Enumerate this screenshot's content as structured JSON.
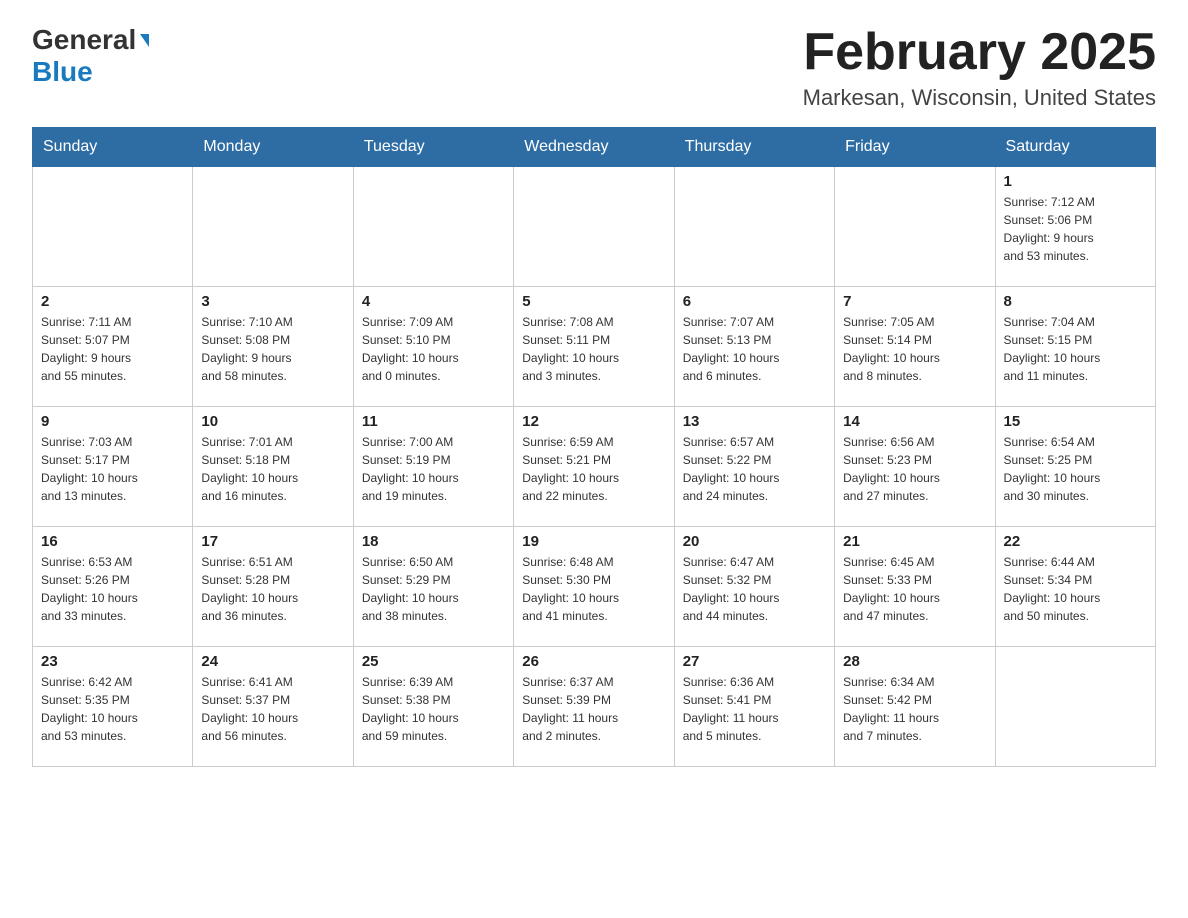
{
  "header": {
    "logo_line1": "General",
    "logo_line2": "Blue",
    "title": "February 2025",
    "subtitle": "Markesan, Wisconsin, United States"
  },
  "weekdays": [
    "Sunday",
    "Monday",
    "Tuesday",
    "Wednesday",
    "Thursday",
    "Friday",
    "Saturday"
  ],
  "weeks": [
    [
      {
        "day": "",
        "info": ""
      },
      {
        "day": "",
        "info": ""
      },
      {
        "day": "",
        "info": ""
      },
      {
        "day": "",
        "info": ""
      },
      {
        "day": "",
        "info": ""
      },
      {
        "day": "",
        "info": ""
      },
      {
        "day": "1",
        "info": "Sunrise: 7:12 AM\nSunset: 5:06 PM\nDaylight: 9 hours\nand 53 minutes."
      }
    ],
    [
      {
        "day": "2",
        "info": "Sunrise: 7:11 AM\nSunset: 5:07 PM\nDaylight: 9 hours\nand 55 minutes."
      },
      {
        "day": "3",
        "info": "Sunrise: 7:10 AM\nSunset: 5:08 PM\nDaylight: 9 hours\nand 58 minutes."
      },
      {
        "day": "4",
        "info": "Sunrise: 7:09 AM\nSunset: 5:10 PM\nDaylight: 10 hours\nand 0 minutes."
      },
      {
        "day": "5",
        "info": "Sunrise: 7:08 AM\nSunset: 5:11 PM\nDaylight: 10 hours\nand 3 minutes."
      },
      {
        "day": "6",
        "info": "Sunrise: 7:07 AM\nSunset: 5:13 PM\nDaylight: 10 hours\nand 6 minutes."
      },
      {
        "day": "7",
        "info": "Sunrise: 7:05 AM\nSunset: 5:14 PM\nDaylight: 10 hours\nand 8 minutes."
      },
      {
        "day": "8",
        "info": "Sunrise: 7:04 AM\nSunset: 5:15 PM\nDaylight: 10 hours\nand 11 minutes."
      }
    ],
    [
      {
        "day": "9",
        "info": "Sunrise: 7:03 AM\nSunset: 5:17 PM\nDaylight: 10 hours\nand 13 minutes."
      },
      {
        "day": "10",
        "info": "Sunrise: 7:01 AM\nSunset: 5:18 PM\nDaylight: 10 hours\nand 16 minutes."
      },
      {
        "day": "11",
        "info": "Sunrise: 7:00 AM\nSunset: 5:19 PM\nDaylight: 10 hours\nand 19 minutes."
      },
      {
        "day": "12",
        "info": "Sunrise: 6:59 AM\nSunset: 5:21 PM\nDaylight: 10 hours\nand 22 minutes."
      },
      {
        "day": "13",
        "info": "Sunrise: 6:57 AM\nSunset: 5:22 PM\nDaylight: 10 hours\nand 24 minutes."
      },
      {
        "day": "14",
        "info": "Sunrise: 6:56 AM\nSunset: 5:23 PM\nDaylight: 10 hours\nand 27 minutes."
      },
      {
        "day": "15",
        "info": "Sunrise: 6:54 AM\nSunset: 5:25 PM\nDaylight: 10 hours\nand 30 minutes."
      }
    ],
    [
      {
        "day": "16",
        "info": "Sunrise: 6:53 AM\nSunset: 5:26 PM\nDaylight: 10 hours\nand 33 minutes."
      },
      {
        "day": "17",
        "info": "Sunrise: 6:51 AM\nSunset: 5:28 PM\nDaylight: 10 hours\nand 36 minutes."
      },
      {
        "day": "18",
        "info": "Sunrise: 6:50 AM\nSunset: 5:29 PM\nDaylight: 10 hours\nand 38 minutes."
      },
      {
        "day": "19",
        "info": "Sunrise: 6:48 AM\nSunset: 5:30 PM\nDaylight: 10 hours\nand 41 minutes."
      },
      {
        "day": "20",
        "info": "Sunrise: 6:47 AM\nSunset: 5:32 PM\nDaylight: 10 hours\nand 44 minutes."
      },
      {
        "day": "21",
        "info": "Sunrise: 6:45 AM\nSunset: 5:33 PM\nDaylight: 10 hours\nand 47 minutes."
      },
      {
        "day": "22",
        "info": "Sunrise: 6:44 AM\nSunset: 5:34 PM\nDaylight: 10 hours\nand 50 minutes."
      }
    ],
    [
      {
        "day": "23",
        "info": "Sunrise: 6:42 AM\nSunset: 5:35 PM\nDaylight: 10 hours\nand 53 minutes."
      },
      {
        "day": "24",
        "info": "Sunrise: 6:41 AM\nSunset: 5:37 PM\nDaylight: 10 hours\nand 56 minutes."
      },
      {
        "day": "25",
        "info": "Sunrise: 6:39 AM\nSunset: 5:38 PM\nDaylight: 10 hours\nand 59 minutes."
      },
      {
        "day": "26",
        "info": "Sunrise: 6:37 AM\nSunset: 5:39 PM\nDaylight: 11 hours\nand 2 minutes."
      },
      {
        "day": "27",
        "info": "Sunrise: 6:36 AM\nSunset: 5:41 PM\nDaylight: 11 hours\nand 5 minutes."
      },
      {
        "day": "28",
        "info": "Sunrise: 6:34 AM\nSunset: 5:42 PM\nDaylight: 11 hours\nand 7 minutes."
      },
      {
        "day": "",
        "info": ""
      }
    ]
  ]
}
